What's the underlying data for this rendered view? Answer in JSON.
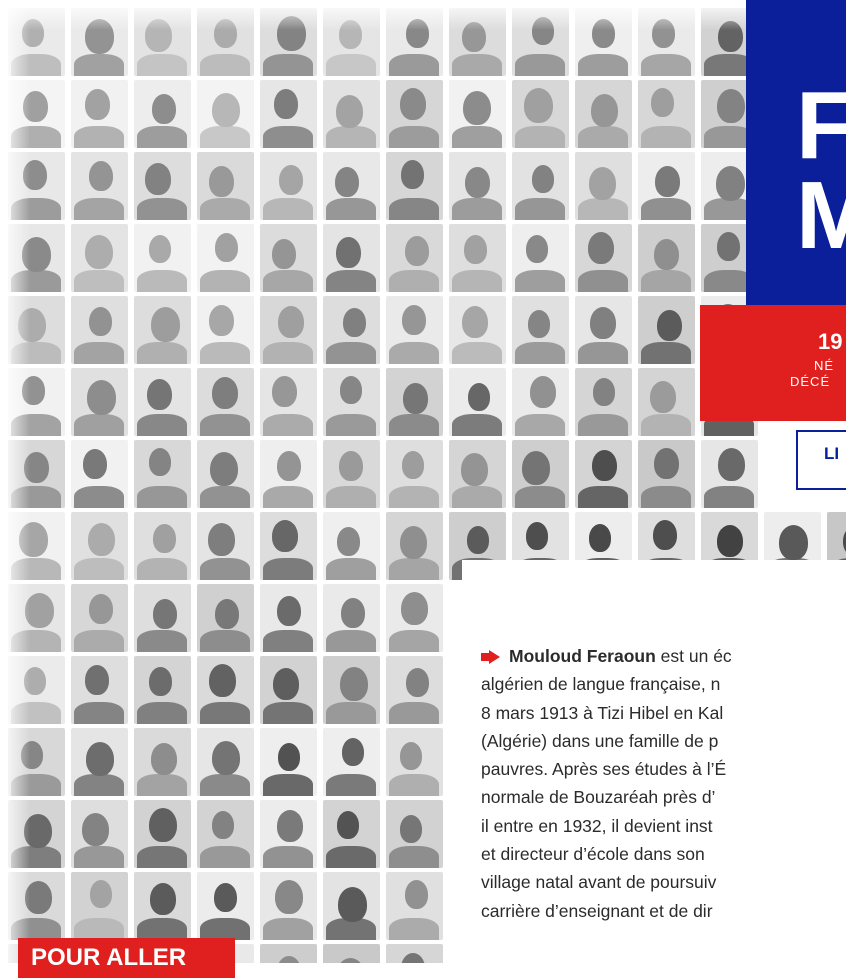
{
  "title": {
    "line1": "F",
    "line2": "M"
  },
  "dates": {
    "year": "19",
    "born": "NÉ",
    "died": "DÉCÉ"
  },
  "category": {
    "label": "LI"
  },
  "bio": {
    "name": "Mouloud Feraoun",
    "lines": [
      " est un éc",
      "algérien de langue française, n",
      "8 mars 1913 à Tizi Hibel en Kal",
      "(Algérie) dans une famille de p",
      "pauvres. Après ses études à l’É",
      "normale de Bouzaréah près d’",
      "il entre en 1932, il devient inst",
      "et directeur d’école dans son",
      "village natal avant de poursuiv",
      "carrière d’enseignant et de dir"
    ]
  },
  "more": {
    "label": "POUR ALLER"
  },
  "icons": {
    "bullet": "arrow-right-icon"
  },
  "colors": {
    "blue": "#0b1f9b",
    "red": "#e0201f",
    "text": "#2b2b2b",
    "mosaic": "#9a9a9a"
  }
}
